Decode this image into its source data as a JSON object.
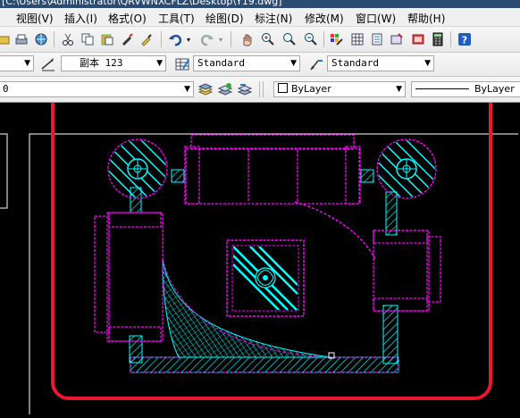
{
  "window": {
    "title": "[C:\\Users\\Administrator\\QRVWNXCFLZ\\Desktop\\Y19.dwg]"
  },
  "menu": [
    {
      "label": "视图(V)"
    },
    {
      "label": "插入(I)"
    },
    {
      "label": "格式(O)"
    },
    {
      "label": "工具(T)"
    },
    {
      "label": "绘图(D)"
    },
    {
      "label": "标注(N)"
    },
    {
      "label": "修改(M)"
    },
    {
      "label": "窗口(W)"
    },
    {
      "label": "帮助(H)"
    }
  ],
  "styles_toolbar": {
    "dim_style": "副本 123",
    "table_style": "Standard",
    "multileader_style": "Standard"
  },
  "layers_toolbar": {
    "layer": "0",
    "color": "ByLayer",
    "linetype": "ByLayer"
  },
  "colors": {
    "furniture": "#ff00ff",
    "hatch": "#00ffff",
    "highlight": "#e8192c",
    "canvas": "#000000"
  },
  "icons": [
    "pan-icon",
    "zoom-realtime-icon",
    "zoom-window-icon",
    "zoom-previous-icon",
    "properties-icon",
    "design-center-icon",
    "tool-palettes-icon",
    "sheet-set-icon",
    "markup-icon",
    "calculator-icon",
    "help-icon",
    "undo-icon",
    "redo-icon",
    "cut-icon",
    "copy-icon",
    "paste-icon",
    "match-properties-icon",
    "block-editor-icon",
    "layer-manager-icon",
    "layer-state-icon",
    "layer-previous-icon"
  ]
}
